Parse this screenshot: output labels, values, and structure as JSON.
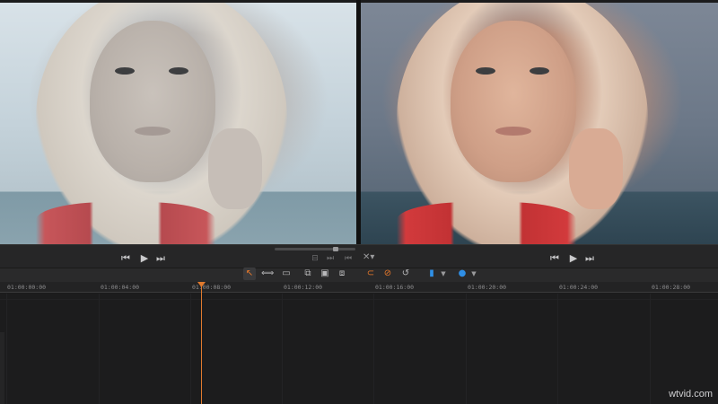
{
  "viewers": {
    "source_label": "",
    "output_label": ""
  },
  "transport": {
    "left": {
      "prev": "⏮",
      "play": "▶",
      "next": "⏭"
    },
    "right": {
      "prev": "⏮",
      "play": "▶",
      "next": "⏭"
    },
    "mini_icons": [
      "⊟",
      "⏭",
      "⏮"
    ],
    "split_icon": "✕▾"
  },
  "toolbar": {
    "tools": [
      {
        "name": "selection-icon",
        "glyph": "↖",
        "tone": "orange"
      },
      {
        "name": "trim-icon",
        "glyph": "⟺",
        "tone": "normal"
      },
      {
        "name": "blade-icon",
        "glyph": "▭",
        "tone": "normal"
      },
      {
        "name": "insert-icon",
        "glyph": "⧉",
        "tone": "normal"
      },
      {
        "name": "overwrite-icon",
        "glyph": "▣",
        "tone": "normal"
      },
      {
        "name": "replace-icon",
        "glyph": "⧈",
        "tone": "normal"
      },
      {
        "name": "snap-icon",
        "glyph": "⊂",
        "tone": "orange"
      },
      {
        "name": "link-icon",
        "glyph": "⊘",
        "tone": "orange"
      },
      {
        "name": "loop-icon",
        "glyph": "↺",
        "tone": "normal"
      },
      {
        "name": "flag-icon",
        "glyph": "▮",
        "tone": "blue"
      },
      {
        "name": "marker-icon",
        "glyph": "●",
        "tone": "blue"
      }
    ]
  },
  "ruler": {
    "timecodes": [
      "01:00:00:00",
      "01:00:04:00",
      "01:00:08:00",
      "01:00:12:00",
      "01:00:16:00",
      "01:00:20:00",
      "01:00:24:00",
      "01:00:28:00"
    ]
  },
  "watermark": "wtvid.com"
}
